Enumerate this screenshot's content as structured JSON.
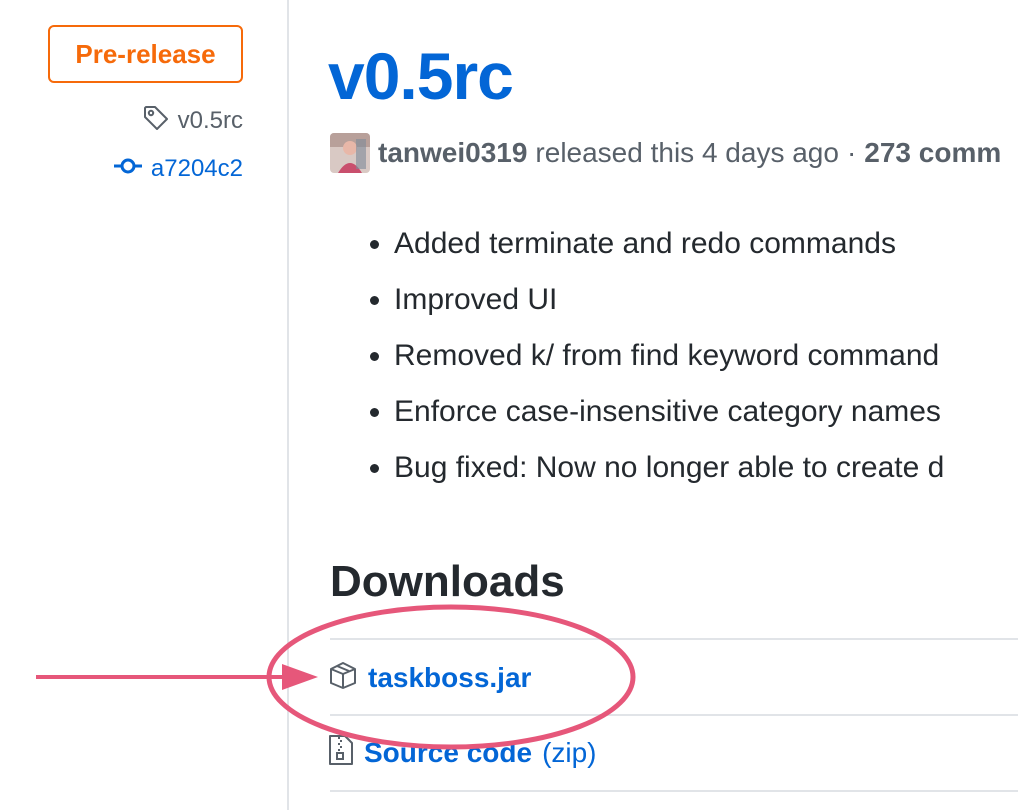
{
  "sidebar": {
    "badge": "Pre-release",
    "tag_name": "v0.5rc",
    "commit_sha": "a7204c2"
  },
  "release": {
    "title": "v0.5rc",
    "author": "tanwei0319",
    "released_text": "released this 4 days ago",
    "separator": "·",
    "commits_text": "273 comm"
  },
  "notes": [
    "Added terminate and redo commands",
    "Improved UI",
    "Removed k/ from find keyword command",
    "Enforce case-insensitive category names",
    "Bug fixed: Now no longer able to create d"
  ],
  "downloads": {
    "heading": "Downloads",
    "assets": [
      {
        "name": "taskboss.jar",
        "icon": "package-icon"
      },
      {
        "name": "Source code",
        "suffix": "(zip)",
        "icon": "file-zip-icon"
      }
    ]
  },
  "colors": {
    "prerelease": "#f66a0a",
    "link": "#0366d6",
    "annotation": "#e6577a"
  }
}
